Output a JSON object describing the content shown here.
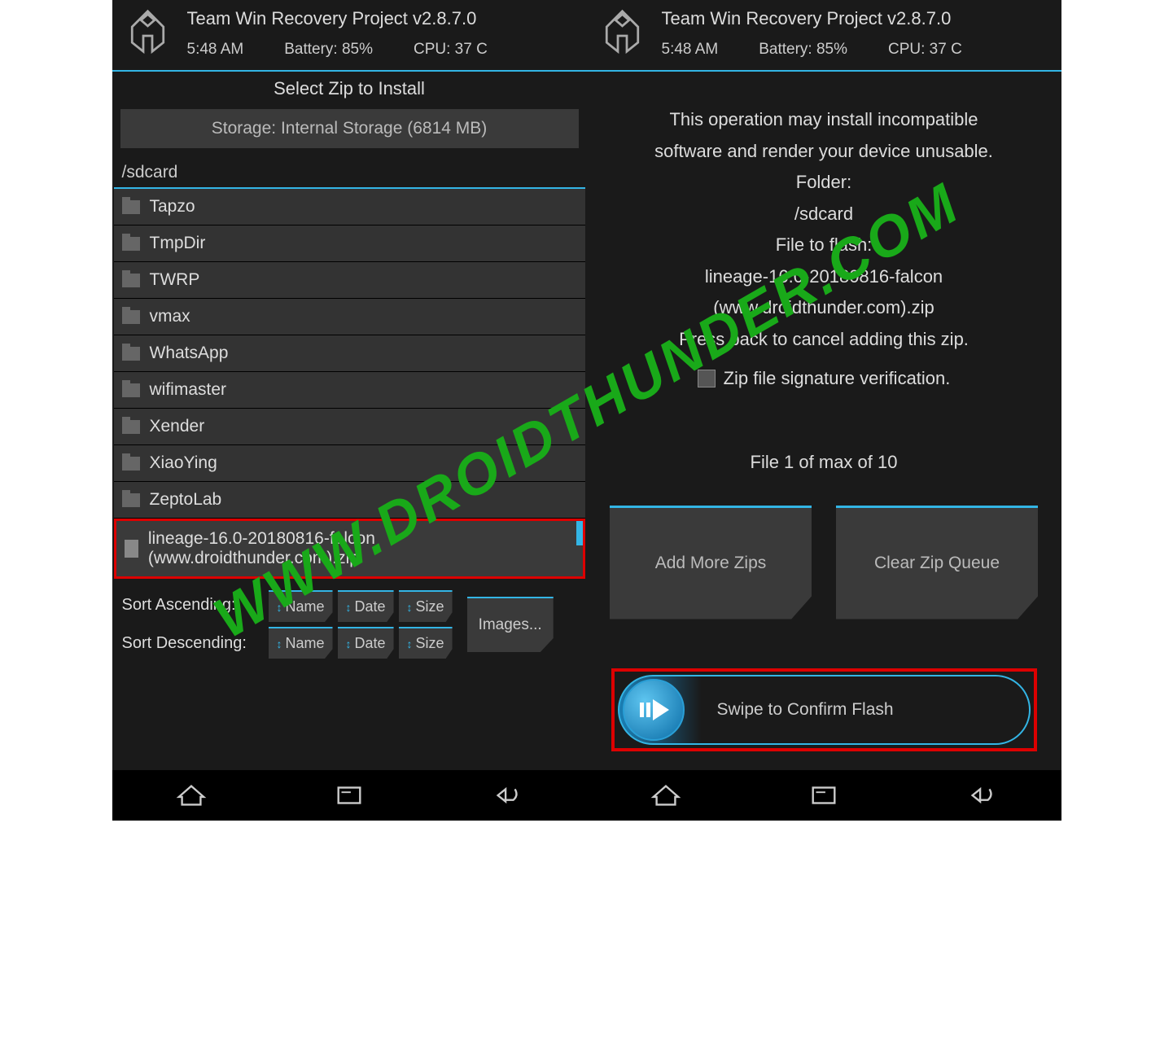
{
  "header": {
    "title": "Team Win Recovery Project  v2.8.7.0",
    "time": "5:48 AM",
    "battery": "Battery: 85%",
    "cpu": "CPU: 37 C"
  },
  "left": {
    "subtitle": "Select Zip to Install",
    "storage": "Storage: Internal Storage (6814 MB)",
    "path": "/sdcard",
    "items": [
      "Tapzo",
      "TmpDir",
      "TWRP",
      "vmax",
      "WhatsApp",
      "wifimaster",
      "Xender",
      "XiaoYing",
      "ZeptoLab"
    ],
    "zip_file": "lineage-16.0-20180816-falcon (www.droidthunder.com).zip",
    "sort_asc": "Sort Ascending:",
    "sort_desc": "Sort Descending:",
    "name": "Name",
    "date": "Date",
    "size": "Size",
    "images": "Images..."
  },
  "right": {
    "warn1": "This operation may install incompatible",
    "warn2": "software and render your device unusable.",
    "folder_label": "Folder:",
    "folder": "/sdcard",
    "flash_label": "File to flash:",
    "flash_file": "lineage-16.0-20180816-falcon (www.droidthunder.com).zip",
    "back_msg": "Press back to cancel adding this zip.",
    "sig_check": "Zip file signature verification.",
    "file_count": "File 1 of max of 10",
    "add_more": "Add More Zips",
    "clear_queue": "Clear Zip Queue",
    "swipe": "Swipe to Confirm Flash"
  },
  "watermark": "WWW.DROIDTHUNDER.COM"
}
